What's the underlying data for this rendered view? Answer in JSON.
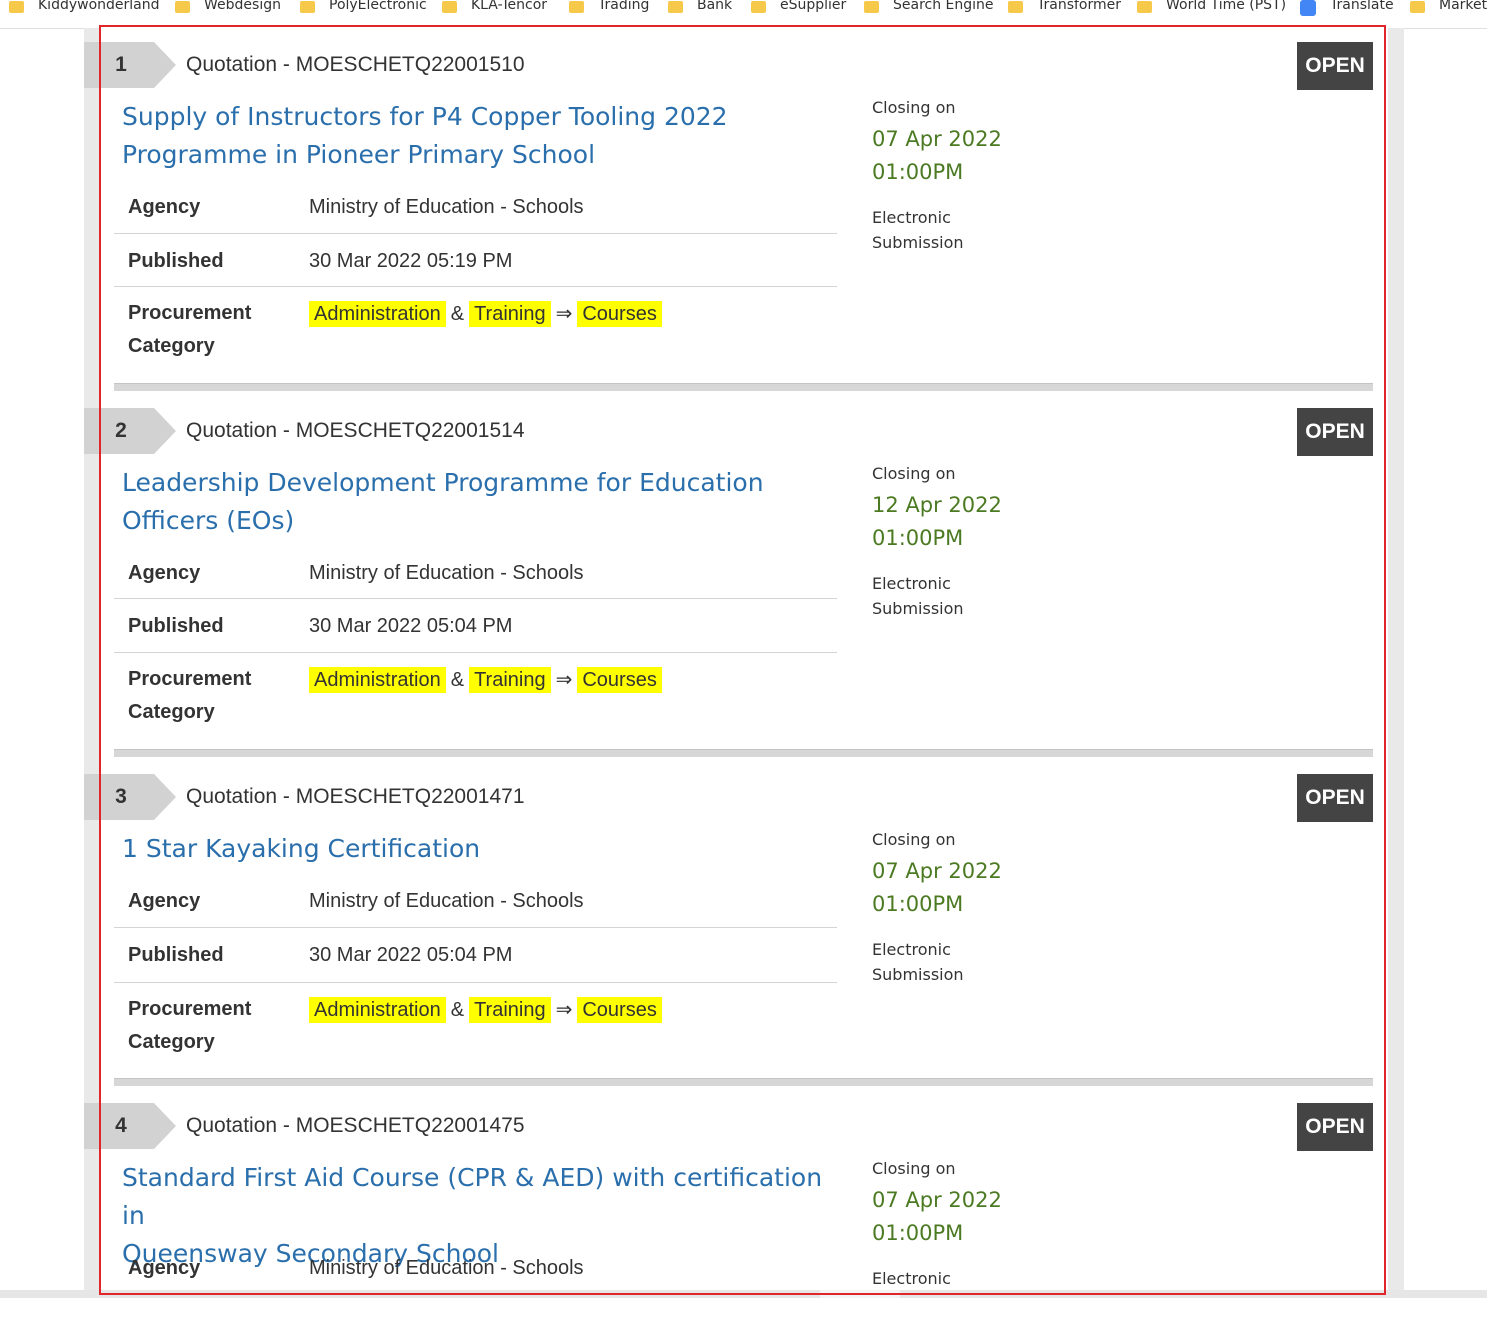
{
  "bookmarks": [
    {
      "label": "Kiddywonderland",
      "icon": "folder-icon"
    },
    {
      "label": "Webdesign",
      "icon": "folder-icon"
    },
    {
      "label": "PolyElectronic",
      "icon": "folder-icon"
    },
    {
      "label": "KLA-Tencor",
      "icon": "folder-icon"
    },
    {
      "label": "Trading",
      "icon": "folder-icon"
    },
    {
      "label": "Bank",
      "icon": "folder-icon"
    },
    {
      "label": "eSupplier",
      "icon": "folder-icon"
    },
    {
      "label": "Search Engine",
      "icon": "folder-icon"
    },
    {
      "label": "Transformer",
      "icon": "folder-icon"
    },
    {
      "label": "World Time (PST)",
      "icon": "folder-icon"
    },
    {
      "label": "Translate",
      "icon": "google-translate-icon"
    },
    {
      "label": "Marketi",
      "icon": "folder-icon"
    }
  ],
  "labels": {
    "agency": "Agency",
    "published": "Published",
    "procurement_line1": "Procurement",
    "procurement_line2": "Category",
    "closing_on": "Closing on",
    "submission_line1": "Electronic",
    "submission_line2": "Submission",
    "amp": "&",
    "arrow": "⇒"
  },
  "colors": {
    "title_link": "#2a6fac",
    "closing_date": "#4b7a22",
    "highlight": "#ffff00",
    "status_bg": "#444444",
    "selection_frame": "#e0262a"
  },
  "tenders": [
    {
      "index": "1",
      "ref": "Quotation - MOESCHETQ22001510",
      "status": "OPEN",
      "title_line1": "Supply of Instructors for P4 Copper Tooling 2022",
      "title_line2": "Programme in Pioneer Primary School",
      "agency": "Ministry of Education - Schools",
      "published": "30 Mar 2022 05:19 PM",
      "category": [
        "Administration",
        "Training",
        "Courses"
      ],
      "closing_date": "07 Apr 2022",
      "closing_time": "01:00PM"
    },
    {
      "index": "2",
      "ref": "Quotation - MOESCHETQ22001514",
      "status": "OPEN",
      "title_line1": "Leadership Development Programme for Education",
      "title_line2": "Officers (EOs)",
      "agency": "Ministry of Education - Schools",
      "published": "30 Mar 2022 05:04 PM",
      "category": [
        "Administration",
        "Training",
        "Courses"
      ],
      "closing_date": "12 Apr 2022",
      "closing_time": "01:00PM"
    },
    {
      "index": "3",
      "ref": "Quotation - MOESCHETQ22001471",
      "status": "OPEN",
      "title_line1": "1 Star Kayaking Certification",
      "title_line2": "",
      "agency": "Ministry of Education - Schools",
      "published": "30 Mar 2022 05:04 PM",
      "category": [
        "Administration",
        "Training",
        "Courses"
      ],
      "closing_date": "07 Apr 2022",
      "closing_time": "01:00PM"
    },
    {
      "index": "4",
      "ref": "Quotation - MOESCHETQ22001475",
      "status": "OPEN",
      "title_line1": "Standard First Aid Course (CPR & AED) with certification in",
      "title_line2": "Queensway Secondary School",
      "agency": "Ministry of Education - Schools",
      "closing_date": "07 Apr 2022",
      "closing_time": "01:00PM"
    }
  ]
}
